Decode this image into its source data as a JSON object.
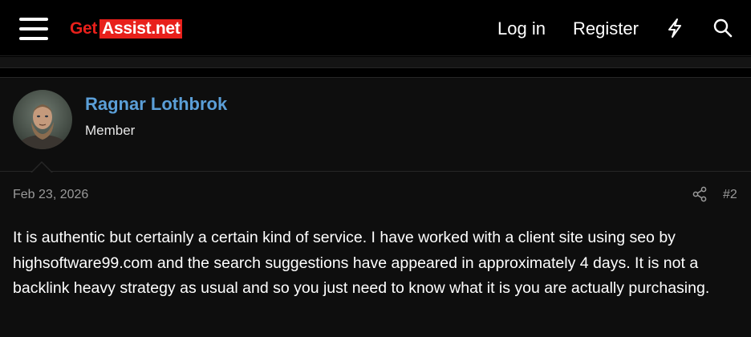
{
  "header": {
    "logo_get": "Get",
    "logo_assist": "Assist.net",
    "login_label": "Log in",
    "register_label": "Register",
    "icons": [
      "menu-icon",
      "bolt-icon",
      "search-icon"
    ]
  },
  "post": {
    "author": {
      "name": "Ragnar Lothbrok",
      "title": "Member",
      "avatar": "avatar-photo"
    },
    "date": "Feb 23, 2026",
    "number": "#2",
    "body": "It is authentic but certainly a certain kind of service. I have worked with a client site using seo by highsoftware99.com and the search suggestions have appeared in approximately 4 days. It is not a backlink heavy strategy as usual and so you just need to know what it is you are actually purchasing."
  },
  "colors": {
    "background": "#000000",
    "post_background": "#0e0e0e",
    "brand_red": "#e8201b",
    "username_blue": "#5b9fd8",
    "meta_gray": "#9a9a9a"
  }
}
